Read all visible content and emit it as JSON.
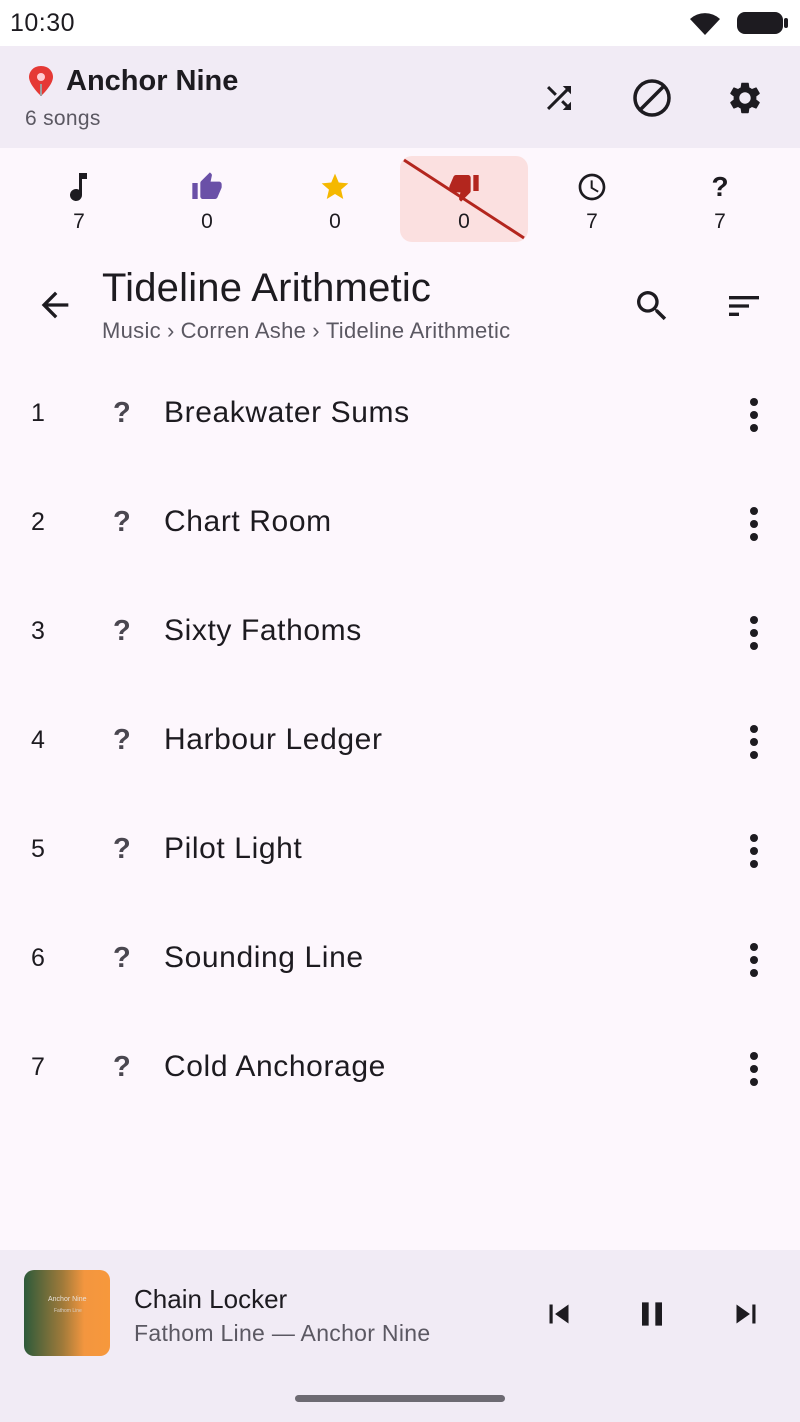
{
  "status_bar": {
    "time": "10:30"
  },
  "header": {
    "location_icon": "pin-icon",
    "title": "Anchor Nine",
    "subtitle": "6 songs",
    "actions": [
      "shuffle-icon",
      "block-icon",
      "gear-icon"
    ]
  },
  "filters": [
    {
      "icon": "music-note-icon",
      "count": "7",
      "selected": false
    },
    {
      "icon": "thumbs-up-icon",
      "count": "0",
      "selected": false
    },
    {
      "icon": "star-icon",
      "count": "0",
      "selected": false
    },
    {
      "icon": "thumbs-down-icon",
      "count": "0",
      "selected": true
    },
    {
      "icon": "clock-icon",
      "count": "7",
      "selected": false
    },
    {
      "icon": "question-icon",
      "glyph": "?",
      "count": "7",
      "selected": false
    }
  ],
  "album": {
    "title": "Tideline Arithmetic",
    "breadcrumb": [
      "Music",
      "›",
      "Corren Ashe",
      "›",
      "Tideline Arithmetic"
    ]
  },
  "tracks": [
    {
      "number": "1",
      "status": "?",
      "title": "Breakwater Sums"
    },
    {
      "number": "2",
      "status": "?",
      "title": "Chart Room"
    },
    {
      "number": "3",
      "status": "?",
      "title": "Sixty Fathoms"
    },
    {
      "number": "4",
      "status": "?",
      "title": "Harbour Ledger"
    },
    {
      "number": "5",
      "status": "?",
      "title": "Pilot Light"
    },
    {
      "number": "6",
      "status": "?",
      "title": "Sounding Line"
    },
    {
      "number": "7",
      "status": "?",
      "title": "Cold Anchorage"
    }
  ],
  "now_playing": {
    "art_title": "Anchor Nine",
    "art_subtitle": "Fathom Line",
    "title": "Chain Locker",
    "subtitle": "Fathom Line — Anchor Nine"
  },
  "colors": {
    "accent": "#6a50a7",
    "star": "#f5b800",
    "dislike": "#b3261e",
    "selected_bg": "#fbe0e0",
    "header_bg": "#f1ebf5",
    "page_bg": "#fdf7fd"
  }
}
